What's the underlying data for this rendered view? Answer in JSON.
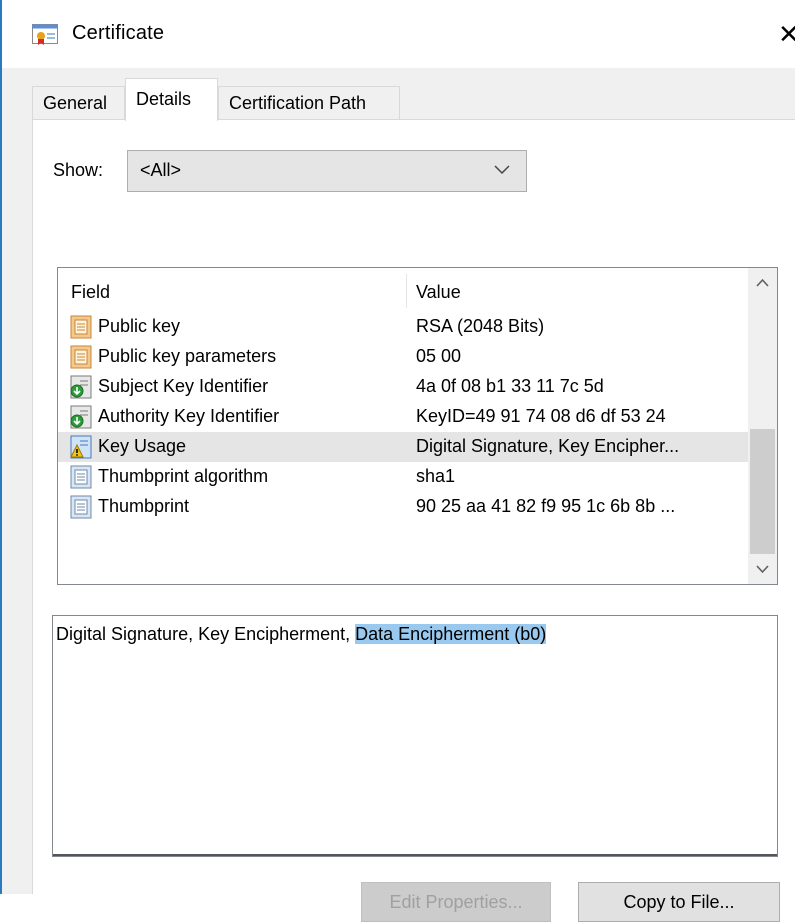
{
  "window": {
    "title": "Certificate",
    "close_glyph": "✕"
  },
  "tabs": [
    {
      "label": "General",
      "active": false
    },
    {
      "label": "Details",
      "active": true
    },
    {
      "label": "Certification Path",
      "active": false
    }
  ],
  "show": {
    "label": "Show:",
    "selected": "<All>"
  },
  "list": {
    "columns": {
      "field": "Field",
      "value": "Value"
    },
    "rows": [
      {
        "field": "Public key",
        "value": "RSA (2048 Bits)",
        "icon": "certificate-field-icon",
        "selected": false
      },
      {
        "field": "Public key parameters",
        "value": "05 00",
        "icon": "certificate-field-icon",
        "selected": false
      },
      {
        "field": "Subject Key Identifier",
        "value": "4a 0f 08 b1 33 11 7c 5d",
        "icon": "extension-icon",
        "selected": false
      },
      {
        "field": "Authority Key Identifier",
        "value": "KeyID=49 91 74 08 d6 df 53 24",
        "icon": "extension-icon",
        "selected": false
      },
      {
        "field": "Key Usage",
        "value": "Digital Signature, Key Encipher...",
        "icon": "critical-extension-icon",
        "selected": true
      },
      {
        "field": "Thumbprint algorithm",
        "value": "sha1",
        "icon": "property-icon",
        "selected": false
      },
      {
        "field": "Thumbprint",
        "value": "90 25 aa 41 82 f9 95 1c 6b 8b ...",
        "icon": "property-icon",
        "selected": false
      }
    ]
  },
  "detail": {
    "text_plain": "Digital Signature, Key Encipherment, ",
    "text_selected": "Data Encipherment (b0)"
  },
  "buttons": {
    "edit_properties": "Edit Properties...",
    "copy_to_file": "Copy to File..."
  },
  "colors": {
    "selection_highlight": "#99c9ef",
    "row_selected": "#e5e5e5",
    "window_border": "#2b79c2"
  }
}
